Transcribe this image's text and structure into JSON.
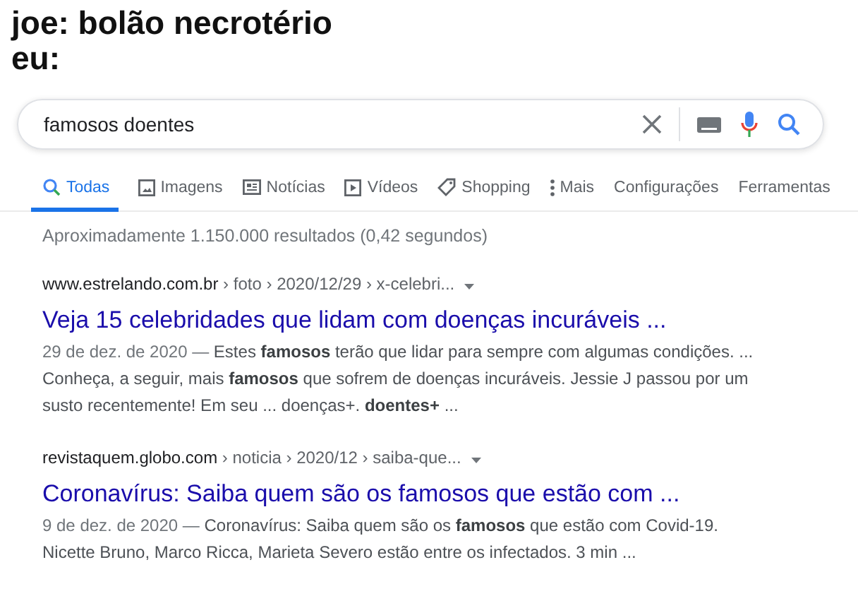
{
  "caption": [
    "joe: bolão necrotério",
    "eu:"
  ],
  "search": {
    "value": "famosos doentes"
  },
  "tabs": [
    {
      "label": "Todas",
      "kind": "search",
      "selected": true
    },
    {
      "label": "Imagens",
      "kind": "image",
      "selected": false
    },
    {
      "label": "Notícias",
      "kind": "news",
      "selected": false
    },
    {
      "label": "Vídeos",
      "kind": "video",
      "selected": false
    },
    {
      "label": "Shopping",
      "kind": "tag",
      "selected": false
    },
    {
      "label": "Mais",
      "kind": "more",
      "selected": false
    },
    {
      "label": "Configurações",
      "kind": "text",
      "selected": false
    },
    {
      "label": "Ferramentas",
      "kind": "text",
      "selected": false
    }
  ],
  "result_stats": "Aproximadamente 1.150.000 resultados (0,42 segundos)",
  "results": [
    {
      "site": "www.estrelando.com.br",
      "path": " › foto › 2020/12/29 › x-celebri...",
      "title": "Veja 15 celebridades que lidam com doenças incuráveis ...",
      "date": "29 de dez. de 2020 —",
      "lines": [
        "Estes **famosos** terão que lidar para sempre com algumas condições. ...",
        "Conheça, a seguir, mais **famosos** que sofrem de doenças incuráveis. Jessie J passou por um",
        "susto recentemente! Em seu ... doenças+. **doentes+** ..."
      ]
    },
    {
      "site": "revistaquem.globo.com",
      "path": " › noticia › 2020/12 › saiba-que...",
      "title": "Coronavírus: Saiba quem são os famosos que estão com ...",
      "date": "9 de dez. de 2020 —",
      "lines": [
        "Coronavírus: Saiba quem são os **famosos** que estão com Covid-19.",
        "Nicette Bruno, Marco Ricca, Marieta Severo estão entre os infectados. 3 min ..."
      ]
    }
  ]
}
